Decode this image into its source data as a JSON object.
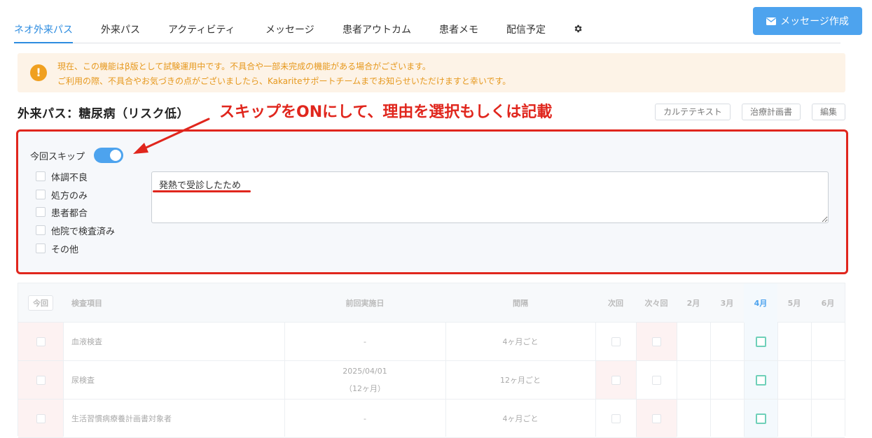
{
  "tabs": [
    {
      "label": "ネオ外来パス",
      "active": true
    },
    {
      "label": "外来パス"
    },
    {
      "label": "アクティビティ"
    },
    {
      "label": "メッセージ"
    },
    {
      "label": "患者アウトカム"
    },
    {
      "label": "患者メモ"
    },
    {
      "label": "配信予定"
    }
  ],
  "settings_icon": "gear-icon",
  "message_button": {
    "label": "メッセージ作成",
    "icon": "envelope-icon"
  },
  "banner": {
    "icon": "exclamation-icon",
    "line1": "現在、この機能はβ版として試験運用中です。不具合や一部未完成の機能がある場合がございます。",
    "line2": "ご利用の際、不具合やお気づきの点がございましたら、Kakariteサポートチームまでお知らせいただけますと幸いです。"
  },
  "page_title": "外来パス：糖尿病（リスク低）",
  "annotation": "スキップをONにして、理由を選択もしくは記載",
  "header_buttons": {
    "karte": "カルテテキスト",
    "plan": "治療計画書",
    "edit": "編集"
  },
  "skip": {
    "label": "今回スキップ",
    "enabled": true,
    "reasons": [
      "体調不良",
      "処方のみ",
      "患者都合",
      "他院で検査済み",
      "その他"
    ],
    "reason_text": "発熱で受診したため"
  },
  "table": {
    "headers": {
      "today": "今回",
      "item": "検査項目",
      "last": "前回実施日",
      "interval": "間隔",
      "next": "次回",
      "after_next": "次々回",
      "months": [
        "2月",
        "3月",
        "4月",
        "5月",
        "6月"
      ]
    },
    "rows": [
      {
        "item": "血液検査",
        "last": "-",
        "last_sub": "",
        "interval": "4ヶ月ごと"
      },
      {
        "item": "尿検査",
        "last": "2025/04/01",
        "last_sub": "（12ヶ月）",
        "interval": "12ヶ月ごと"
      },
      {
        "item": "生活習慣病療養計画書対象者",
        "last": "-",
        "last_sub": "",
        "interval": "4ヶ月ごと"
      }
    ]
  },
  "colors": {
    "accent": "#2d8ce0",
    "annotation_red": "#e0261d",
    "warning": "#f0a020",
    "check_green": "#6fd0b9"
  }
}
